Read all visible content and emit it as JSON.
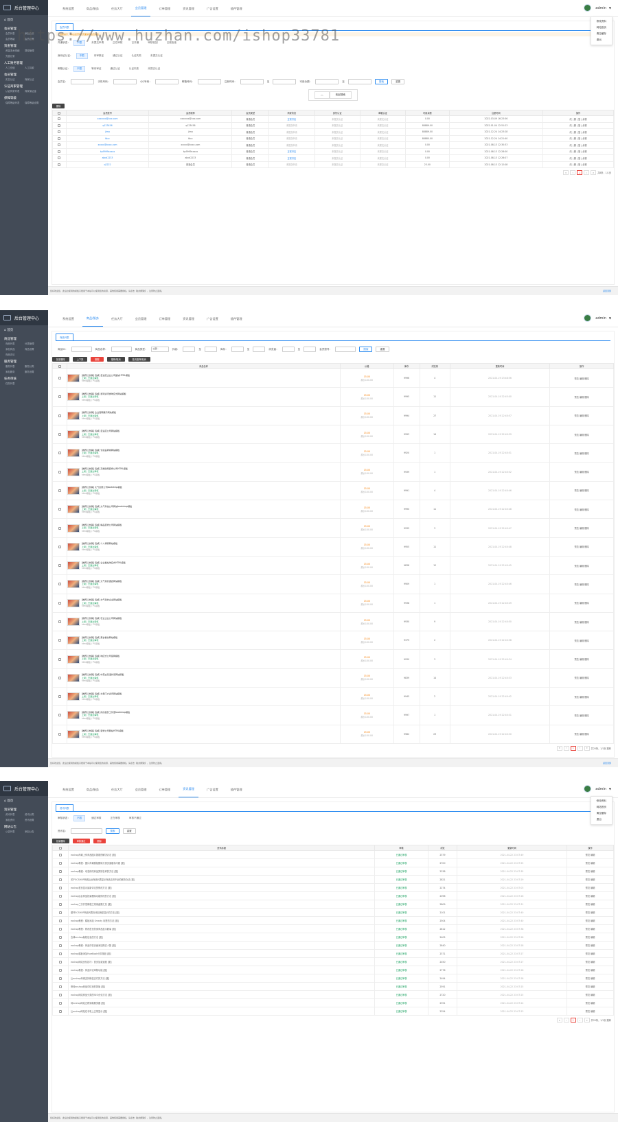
{
  "brand": "后台管理中心",
  "watermark": "https://www.huzhan.com/ishop33781",
  "user": {
    "name": "admin",
    "menu": [
      "修改资料",
      "网站首页",
      "清空缓存",
      "退出"
    ]
  },
  "footer": {
    "text": "您好欢迎您，此后台使用的模板只能用于本站可以使用您的资源，其他使用需要授权。请点击【在线帮助】，注意防止盗用。",
    "right": "返回顶部"
  },
  "s1": {
    "nav": [
      "系统设置",
      "商品/服务",
      "任务大厅",
      "会员管理",
      "订单管理",
      "资讯管理",
      "广告设置",
      "插件管理"
    ],
    "nav_active": 3,
    "sidebar": [
      {
        "group": "会员管理",
        "items": [
          "会员列表",
          "添加会员",
          "会员等级",
          "会员设置"
        ]
      },
      {
        "group": "资金管理",
        "items": [
          "资金流水明细",
          "提现管理",
          "充值记录"
        ]
      },
      {
        "group": "人工财务管理",
        "items": [
          "人工充值",
          "人工扣款"
        ]
      },
      {
        "group": "会员管理",
        "items": [
          "实名认证",
          "商家认证"
        ]
      },
      {
        "group": "认证商家管理",
        "items": [
          "认证商家列表",
          "商家保证金"
        ]
      },
      {
        "group": "保障等级",
        "items": [
          "保障等级列表",
          "保障等级设置"
        ]
      }
    ],
    "tab": "会员列表",
    "notice": "温馨提示：请在会员列表页面操作会员信息",
    "filters": [
      {
        "label": "开通状态：",
        "chips": [
          "不限",
          "未提交申请",
          "正在审核",
          "已开通",
          "审核驳回",
          "已被拒绝"
        ]
      },
      {
        "label": "身份证认证：",
        "chips": [
          "不限",
          "待审核证",
          "通过认证",
          "认证失败",
          "未提交认证"
        ]
      },
      {
        "label": "邮箱认证：",
        "chips": [
          "不限",
          "等待审证",
          "通过认证",
          "认证失败",
          "未提交认证"
        ]
      }
    ],
    "search_fields": [
      "会员名：",
      "手机号码：",
      "QQ号码：",
      "邮箱号码：",
      "注册时间：",
      "至",
      "可用余额：",
      "至"
    ],
    "search_btn": "搜索",
    "reset_btn": "重置",
    "collapse": "收起搜索",
    "del_btn": "删除",
    "columns": [
      "",
      "会员账号",
      "会员昵称",
      "会员类型",
      "商家状态",
      "身份认证",
      "邮箱认证",
      "可用余额",
      "注册时间",
      "操作"
    ],
    "rows": [
      [
        "xxxxxxx@xxx.com",
        "xxxxxxx@xxx.com",
        "普通会员",
        "正常开店",
        "未提交认证",
        "未提交认证",
        "0.00",
        "2022-03-09 16:23:56"
      ],
      [
        "q123456",
        "q123456",
        "普通会员",
        "未提交申请",
        "未提交认证",
        "未提交认证",
        "88889.00",
        "2022-01-04 12:51:23"
      ],
      [
        "jimo",
        "jimo",
        "普通会员",
        "未提交申请",
        "未提交认证",
        "未提交认证",
        "88889.00",
        "2021-12-24 14:23:28"
      ],
      [
        "fbcc",
        "fbcc",
        "普通会员",
        "未提交申请",
        "未提交认证",
        "未提交认证",
        "88880.00",
        "2021-12-24 14:21:40"
      ],
      [
        "xxxxx@xxxx.com",
        "xxxxx@xxxx.com",
        "普通会员",
        "未提交申请",
        "未提交认证",
        "未提交认证",
        "0.00",
        "2021-08-13 12:30:33"
      ],
      [
        "kp9999xxxxx",
        "kp9999xxxxx",
        "普通会员",
        "正常开店",
        "未提交认证",
        "未提交认证",
        "0.00",
        "2021-08-13 12:28:00"
      ],
      [
        "abcd2233",
        "abcd2233",
        "普通会员",
        "正常开店",
        "未提交认证",
        "未提交认证",
        "0.00",
        "2021-08-13 12:26:07"
      ],
      [
        "q2222",
        "普通会员",
        "普通会员",
        "未提交申请",
        "未提交认证",
        "未提交认证",
        "23.00",
        "2021-08-13 12:12:08"
      ]
    ],
    "ops": "改 | 删 | 登 | 余额",
    "pager": {
      "current": "1",
      "total": "共8条，1/1页"
    }
  },
  "s2": {
    "nav": [
      "系统设置",
      "商品/服务",
      "任务大厅",
      "会员管理",
      "订单管理",
      "资讯管理",
      "广告设置",
      "插件管理"
    ],
    "nav_active": 1,
    "sidebar": [
      {
        "group": "商品管理",
        "items": [
          "商品列表",
          "分类管理",
          "添加商品",
          "商品设置",
          "商品评论"
        ]
      },
      {
        "group": "服务管理",
        "items": [
          "服务列表",
          "服务分类",
          "添加服务",
          "服务设置"
        ]
      },
      {
        "group": "任务审核",
        "items": [
          "任务列表"
        ]
      }
    ],
    "tab": "商品列表",
    "search": [
      "商品ID：",
      "商品名称：",
      "商品类型：",
      "--全部--",
      "价格：",
      "至",
      "库存：",
      "至",
      "浏览量：",
      "至",
      "会员账号：",
      "搜索",
      "重置"
    ],
    "actions": [
      "批量删除",
      "上下架",
      "删除",
      "推荐/取消",
      "首页推荐/取消"
    ],
    "columns": [
      "",
      "商品名称",
      "价格",
      "库存",
      "浏览量",
      "更新时间",
      "操作"
    ],
    "rows": [
      [
        "[推荐] [热销] 包邮] 自适应企业公司整站HTML模板",
        "15.00",
        "9996",
        "4",
        "2021-04-19 23:48:56"
      ],
      [
        "[推荐] [热销] 包邮] 游戏资讯类响应式网站模板",
        "15.00",
        "9995",
        "11",
        "2021-04-19 22:45:00"
      ],
      [
        "[推荐] [热销] 企业官网展示网站模板",
        "15.00",
        "9994",
        "27",
        "2021-04-19 22:40:57"
      ],
      [
        "[推荐] [热销] 包邮] 自适应公司网站模板",
        "15.00",
        "9993",
        "14",
        "2021-04-19 22:40:59"
      ],
      [
        "[推荐] [热销] 包邮] 化妆品商城网站模板",
        "15.00",
        "9920",
        "1",
        "2021-04-19 22:40:51"
      ],
      [
        "[推荐] [热销] 包邮] 高端建筑装饰公司HTML模板",
        "15.00",
        "9939",
        "1",
        "2021-04-19 22:40:52"
      ],
      [
        "[推荐] [热销] 大气创意公司bootstrap模板",
        "15.00",
        "9991",
        "4",
        "2021-04-19 22:40:46"
      ],
      [
        "[推荐] [热销] 包邮] 大气科技公司网站bootstrap模板",
        "15.00",
        "9990",
        "11",
        "2021-04-19 22:40:48"
      ],
      [
        "[推荐] [热销] 包邮] 精品装修公司网站模板",
        "15.00",
        "9935",
        "3",
        "2021-04-19 22:40:47"
      ],
      [
        "[推荐] [热销] 包邮] 个人博客网站模板",
        "15.00",
        "9955",
        "11",
        "2021-04-19 22:40:48"
      ],
      [
        "[推荐] [热销] 包邮] 企业整站响应式HTML模板",
        "15.00",
        "9838",
        "12",
        "2021-04-19 22:40:45"
      ],
      [
        "[推荐] [热销] 包邮] 大气简约酒店网站模板",
        "15.00",
        "9909",
        "1",
        "2021-04-19 22:40:46"
      ],
      [
        "[推荐] [热销] 包邮] 大气简约企业网站模板",
        "15.00",
        "9938",
        "1",
        "2021-04-19 22:40:49"
      ],
      [
        "[推荐] [热销] 包邮] 农业企业公司网站模板",
        "15.00",
        "9930",
        "9",
        "2021-04-19 22:40:50"
      ],
      [
        "[推荐] [热销] 包邮] 美食餐饮网站模板",
        "15.00",
        "9379",
        "2",
        "2021-04-19 22:40:38"
      ],
      [
        "[推荐] [热销] 包邮] 响应式公司官网模板",
        "15.00",
        "9930",
        "3",
        "2021-04-19 22:40:34"
      ],
      [
        "[推荐] [热销] 包邮] 中英文双语外贸网站模板",
        "15.00",
        "9839",
        "14",
        "2021-04-19 22:40:33"
      ],
      [
        "[推荐] [热销] 包邮] 大型门户资讯网站模板",
        "15.00",
        "9945",
        "2",
        "2021-04-19 22:40:42"
      ],
      [
        "[推荐] [热销] 包邮] 简约摄影工作室bootstrap模板",
        "15.00",
        "9997",
        "1",
        "2021-04-19 22:40:31"
      ],
      [
        "[推荐] [热销] 包邮] 装修公司网站HTML模板",
        "15.00",
        "9982",
        "23",
        "2021-04-19 22:40:30"
      ]
    ],
    "sub1": "上架 | 已通过审核",
    "sub2": "html模板 / PC模板",
    "orig": "原价100.00",
    "ops": [
      "预览",
      "编辑/删除"
    ],
    "pager": {
      "current": "1",
      "total": "共20条，1/1页  跳转"
    }
  },
  "s3": {
    "nav": [
      "系统设置",
      "商品/服务",
      "任务大厅",
      "会员管理",
      "订单管理",
      "资讯管理",
      "广告设置",
      "插件管理"
    ],
    "nav_active": 5,
    "sidebar": [
      {
        "group": "资讯管理",
        "items": [
          "资讯列表",
          "资讯分类",
          "添加资讯",
          "资讯设置"
        ]
      },
      {
        "group": "网站公告",
        "items": [
          "公告列表",
          "添加公告"
        ]
      }
    ],
    "tab": "资讯列表",
    "chips_label": "审核状态：",
    "chips": [
      "不限",
      "通过审核",
      "正在审核",
      "审核不通过"
    ],
    "search_label": "资讯名：",
    "search_btn": "搜索",
    "reset_btn": "重置",
    "actions": [
      "批量删除",
      "审核通过",
      "删除"
    ],
    "columns": [
      "",
      "资讯标题",
      "审核",
      "浏览",
      "更新时间",
      "操作"
    ],
    "rows": [
      [
        "ecshop商城上传商品图片报错的解决办法 [图]",
        "2379",
        "2021-04-22 23:07:49"
      ],
      [
        "ecshop教程：图片商城模板删除分类页面缓存问题 [图]",
        "2700",
        "2021-04-22 23:07:55"
      ],
      [
        "ecshop教程：动态修改商品类别名称的方法 [图]",
        "2338",
        "2021-04-22 23:07:35"
      ],
      [
        "关于ECSHOP商城后台商品列表显示商品名称不全的解决办法 [图]",
        "2821",
        "2021-04-22 23:07:29"
      ],
      [
        "ecshop首页显示最新评论的修改方法 [图]",
        "2274",
        "2021-04-22 23:07:03"
      ],
      [
        "ecshop后台商品批量删除功能修改的方法 [图]",
        "2096",
        "2021-04-22 23:07:26"
      ],
      [
        "ecshop二次开发教程之常用函数汇总 [图]",
        "2809",
        "2021-04-22 23:07:31"
      ],
      [
        "循环ECSHOP商品列表页添加销量显示的方法 [图]",
        "2101",
        "2021-04-22 23:07:40"
      ],
      [
        "ecshop教程：模板添加 Smarty 标签的方法 [图]",
        "2504",
        "2021-04-22 23:07:40"
      ],
      [
        "ecshop教程：修改首页热卖商品显示数量 [图]",
        "2812",
        "2021-04-22 23:07:38"
      ],
      [
        "去掉ecshop版权信息的方法 [图]",
        "2405",
        "2021-04-22 23:07:28"
      ],
      [
        "ecshop教程：商品详情页面添加购买人数 [图]",
        "2840",
        "2021-04-22 23:07:28"
      ],
      [
        "ecshop模板添加FaceBook分享按钮 [图]",
        "2371",
        "2021-04-22 23:07:27"
      ],
      [
        "ecshop网站优化技巧：首页加载速度 [图]",
        "2450",
        "2021-04-22 23:07:27"
      ],
      [
        "ecshop教程：商品评论审核功能 [图]",
        "2776",
        "2021-04-22 23:07:28"
      ],
      [
        "让ecshop商城支持微信支付的方法 [图]",
        "2494",
        "2021-04-22 23:07:28"
      ],
      [
        "修改ecshop商品详情页的排版 [图]",
        "2591",
        "2021-04-22 23:07:25"
      ],
      [
        "ecshop网站商品分类的SEO优化方法 [图]",
        "2720",
        "2021-04-22 23:07:25"
      ],
      [
        "将ecshop网站迁移到新服务器 [图]",
        "2391",
        "2021-04-22 23:07:24"
      ],
      [
        "让ecshop网站在手机上正常显示 [图]",
        "2354",
        "2021-04-22 23:07:23"
      ]
    ],
    "status": "已通过审核",
    "ops": [
      "预览",
      "编辑"
    ],
    "pager": {
      "current": "1",
      "total": "共20条，1/1页  跳转"
    }
  }
}
